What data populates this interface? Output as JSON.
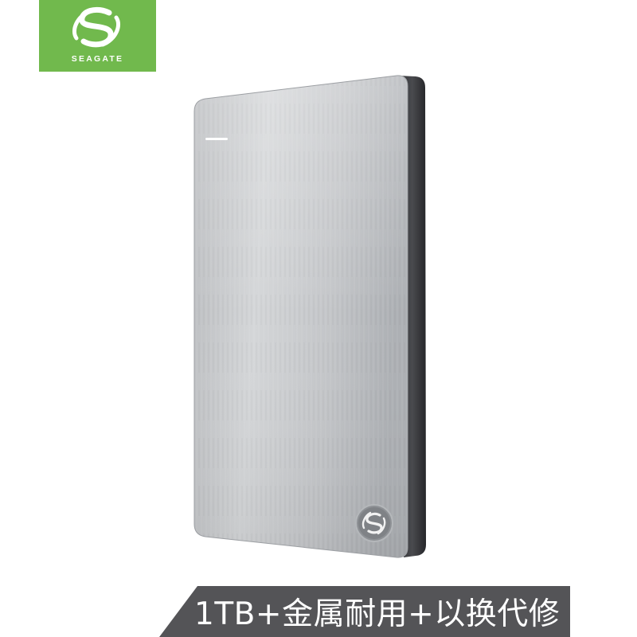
{
  "brand": {
    "name": "SEAGATE",
    "color": "#71b94d",
    "icon": "seagate-swirl-icon"
  },
  "product": {
    "description": "silver brushed-metal portable hard drive",
    "finish_color": "#c6c8cb",
    "edge_color": "#3a3b3e",
    "emblem_icon": "seagate-swirl-icon"
  },
  "banner": {
    "text": "1TB+金属耐用+以换代修",
    "background_color": "#545457",
    "text_color": "#ffffff"
  }
}
